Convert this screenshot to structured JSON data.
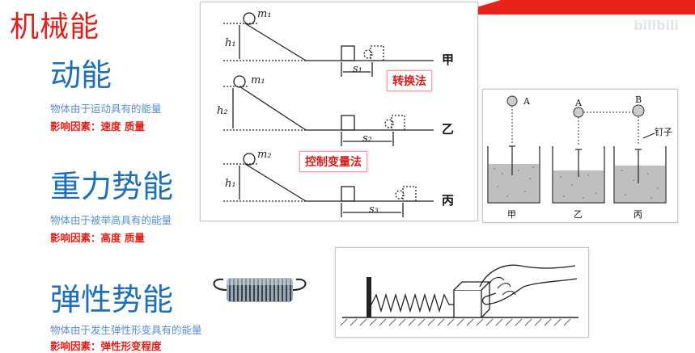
{
  "page": {
    "title": "机械能",
    "watermark": "bilibili"
  },
  "kinetic": {
    "heading": "动能",
    "description": "物体由于运动具有的能量",
    "factors": "影响因素：速度 质量"
  },
  "gravitational": {
    "heading": "重力势能",
    "description": "物体由于被举高具有的能量",
    "factors": "影响因素：高度 质量"
  },
  "elastic": {
    "heading": "弹性势能",
    "description": "物体由于发生弹性形变具有的能量",
    "factors": "影响因素：弹性形变程度"
  },
  "ramp_experiment": {
    "rows": [
      {
        "mass": "m₁",
        "height": "h₁",
        "distance": "s₁",
        "label": "甲"
      },
      {
        "mass": "m₁",
        "height": "h₂",
        "distance": "s₂",
        "label": "乙"
      },
      {
        "mass": "m₂",
        "height": "h₁",
        "distance": "s₃",
        "label": "丙"
      }
    ],
    "method_conversion": "转换法",
    "method_control": "控制变量法"
  },
  "drop_experiment": {
    "ball_labels": [
      "A",
      "A",
      "B"
    ],
    "nail_label": "钉子",
    "container_labels": [
      "甲",
      "乙",
      "丙"
    ]
  },
  "colors": {
    "title_red": "#d8231c",
    "heading_blue": "#1f6fb8",
    "desc_blue": "#5b8ec8",
    "factor_red": "#e0201a"
  }
}
